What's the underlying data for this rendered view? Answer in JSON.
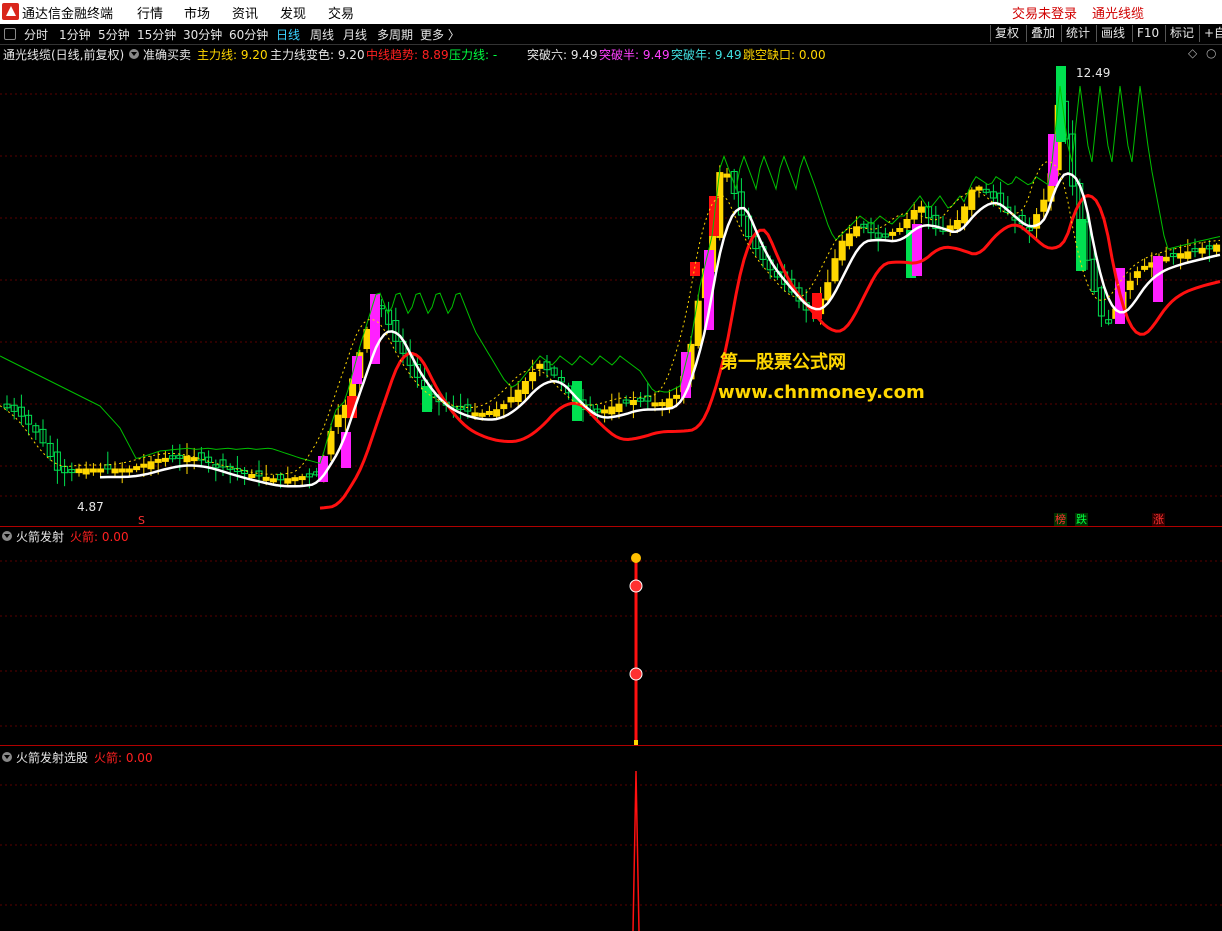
{
  "titlebar": {
    "app_title": "通达信金融终端",
    "menu": [
      "行情",
      "市场",
      "资讯",
      "发现",
      "交易"
    ],
    "trade_status": "交易未登录",
    "indicator_link": "通光线缆"
  },
  "toolbar": {
    "periods": [
      "分时",
      "1分钟",
      "5分钟",
      "15分钟",
      "30分钟",
      "60分钟",
      "日线",
      "周线",
      "月线",
      "多周期",
      "更多 〉"
    ],
    "active_period": "日线",
    "tools": [
      "复权",
      "叠加",
      "统计",
      "画线",
      "F10",
      "标记",
      "+自"
    ]
  },
  "main_panel": {
    "title": "通光线缆(日线,前复权)",
    "indicator_name": "准确买卖",
    "fields": [
      {
        "label": "主力线: 9.20",
        "color": "#ffd700"
      },
      {
        "label": "主力线变色: 9.20",
        "color": "#e6e6e6"
      },
      {
        "label": "中线趋势: 8.89",
        "color": "#ff2020"
      },
      {
        "label": "压力线: -",
        "color": "#00ff40"
      },
      {
        "label": "突破六: 9.49",
        "color": "#e6e6e6"
      },
      {
        "label": "突破半: 9.49",
        "color": "#ff40ff"
      },
      {
        "label": "突破年: 9.49",
        "color": "#40e0e0"
      },
      {
        "label": "跳空缺口: 0.00",
        "color": "#ffd700"
      }
    ],
    "high_label": "12.49",
    "low_label": "4.87",
    "markers": {
      "s": "S",
      "bang": "榜",
      "die": "跌",
      "zhang": "涨"
    },
    "watermark_cn": "第一股票公式网",
    "watermark_url": "www.chnmoney.com"
  },
  "panel2": {
    "title": "火箭发射",
    "field": "火箭: 0.00"
  },
  "panel3": {
    "title": "火箭发射选股",
    "field": "火箭: 0.00"
  },
  "colors": {
    "up": "#ffd700",
    "down": "#00e050",
    "magenta": "#ff20ff",
    "red": "#ff1010",
    "green_line": "#00c000",
    "white": "#ffffff",
    "grid": "#5a0000"
  }
}
